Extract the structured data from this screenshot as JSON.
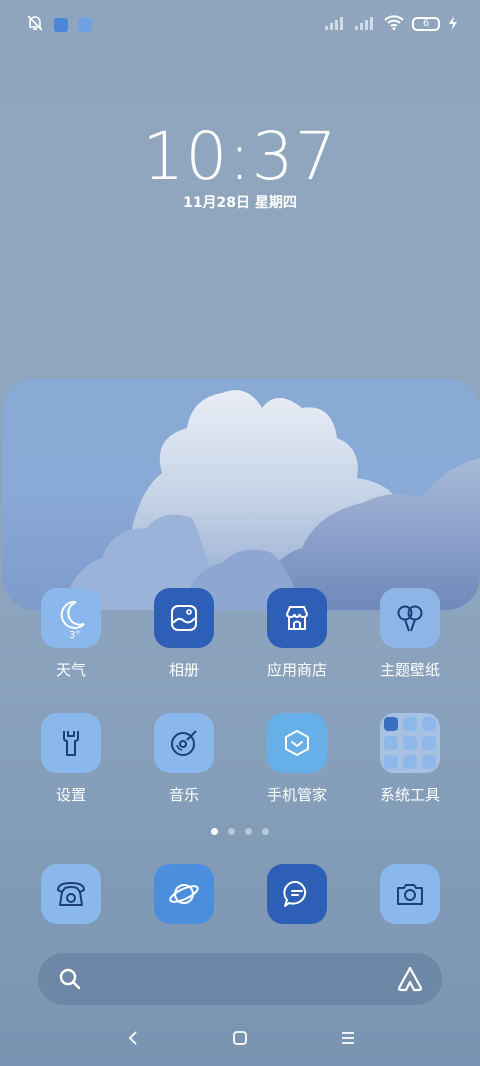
{
  "status_bar": {
    "battery_level": "6",
    "icons": [
      "bell-off-icon",
      "app-notification-icon",
      "app-notification-icon",
      "signal-icon",
      "signal-icon",
      "wifi-icon",
      "battery-icon",
      "charging-icon"
    ]
  },
  "lock": {
    "time": "10:37",
    "date": "11月28日  星期四"
  },
  "apps_row1": [
    {
      "label": "天气",
      "icon": "weather-moon-icon",
      "temp": "3°"
    },
    {
      "label": "相册",
      "icon": "gallery-icon"
    },
    {
      "label": "应用商店",
      "icon": "app-store-icon"
    },
    {
      "label": "主题壁纸",
      "icon": "themes-balloon-icon"
    }
  ],
  "apps_row2": [
    {
      "label": "设置",
      "icon": "settings-wrench-icon"
    },
    {
      "label": "音乐",
      "icon": "music-disc-icon"
    },
    {
      "label": "手机管家",
      "icon": "security-shield-icon"
    },
    {
      "label": "系统工具",
      "icon": "folder-icon"
    }
  ],
  "dock": [
    {
      "icon": "phone-icon"
    },
    {
      "icon": "browser-planet-icon"
    },
    {
      "icon": "messages-icon"
    },
    {
      "icon": "camera-icon"
    }
  ],
  "pages": {
    "count": 4,
    "active": 0
  },
  "colors": {
    "icon_light": "#8ab7ec",
    "icon_dark": "#2d5fb6",
    "background": "#8ea5bd"
  }
}
